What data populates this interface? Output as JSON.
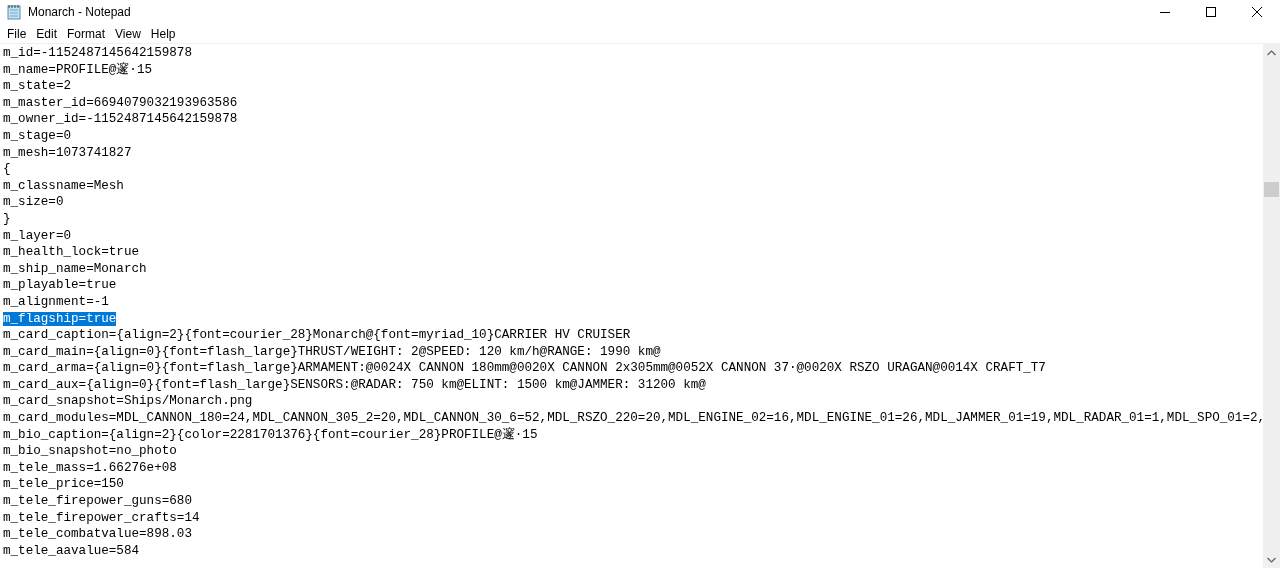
{
  "window": {
    "title": "Monarch - Notepad"
  },
  "menu": [
    "File",
    "Edit",
    "Format",
    "View",
    "Help"
  ],
  "lines": [
    {
      "text": "m_id=-1152487145642159878",
      "selected": false
    },
    {
      "text": "m_name=PROFILE@邃·15",
      "selected": false
    },
    {
      "text": "m_state=2",
      "selected": false
    },
    {
      "text": "m_master_id=6694079032193963586",
      "selected": false
    },
    {
      "text": "m_owner_id=-1152487145642159878",
      "selected": false
    },
    {
      "text": "m_stage=0",
      "selected": false
    },
    {
      "text": "m_mesh=1073741827",
      "selected": false
    },
    {
      "text": "{",
      "selected": false
    },
    {
      "text": "m_classname=Mesh",
      "selected": false
    },
    {
      "text": "m_size=0",
      "selected": false
    },
    {
      "text": "}",
      "selected": false
    },
    {
      "text": "m_layer=0",
      "selected": false
    },
    {
      "text": "m_health_lock=true",
      "selected": false
    },
    {
      "text": "m_ship_name=Monarch",
      "selected": false
    },
    {
      "text": "m_playable=true",
      "selected": false
    },
    {
      "text": "m_alignment=-1",
      "selected": false
    },
    {
      "text": "m_flagship=true",
      "selected": true
    },
    {
      "text": "m_card_caption={align=2}{font=courier_28}Monarch@{font=myriad_10}CARRIER HV CRUISER",
      "selected": false
    },
    {
      "text": "m_card_main={align=0}{font=flash_large}THRUST/WEIGHT: 2@SPEED: 120 km/h@RANGE: 1990 km@",
      "selected": false
    },
    {
      "text": "m_card_arma={align=0}{font=flash_large}ARMAMENT:@0024X CANNON 180mm@0020X CANNON 2x305mm@0052X CANNON 37·@0020X RSZO URAGAN@0014X CRAFT_T7",
      "selected": false
    },
    {
      "text": "m_card_aux={align=0}{font=flash_large}SENSORS:@RADAR: 750 km@ELINT: 1500 km@JAMMER: 31200 km@",
      "selected": false
    },
    {
      "text": "m_card_snapshot=Ships/Monarch.png",
      "selected": false
    },
    {
      "text": "m_card_modules=MDL_CANNON_180=24,MDL_CANNON_305_2=20,MDL_CANNON_30_6=52,MDL_RSZO_220=20,MDL_ENGINE_02=16,MDL_ENGINE_01=26,MDL_JAMMER_01=19,MDL_RADAR_01=1,MDL_SPO_01=2,",
      "selected": false
    },
    {
      "text": "m_bio_caption={align=2}{color=2281701376}{font=courier_28}PROFILE@邃·15",
      "selected": false
    },
    {
      "text": "m_bio_snapshot=no_photo",
      "selected": false
    },
    {
      "text": "m_tele_mass=1.66276e+08",
      "selected": false
    },
    {
      "text": "m_tele_price=150",
      "selected": false
    },
    {
      "text": "m_tele_firepower_guns=680",
      "selected": false
    },
    {
      "text": "m_tele_firepower_crafts=14",
      "selected": false
    },
    {
      "text": "m_tele_combatvalue=898.03",
      "selected": false
    },
    {
      "text": "m_tele_aavalue=584",
      "selected": false
    }
  ]
}
